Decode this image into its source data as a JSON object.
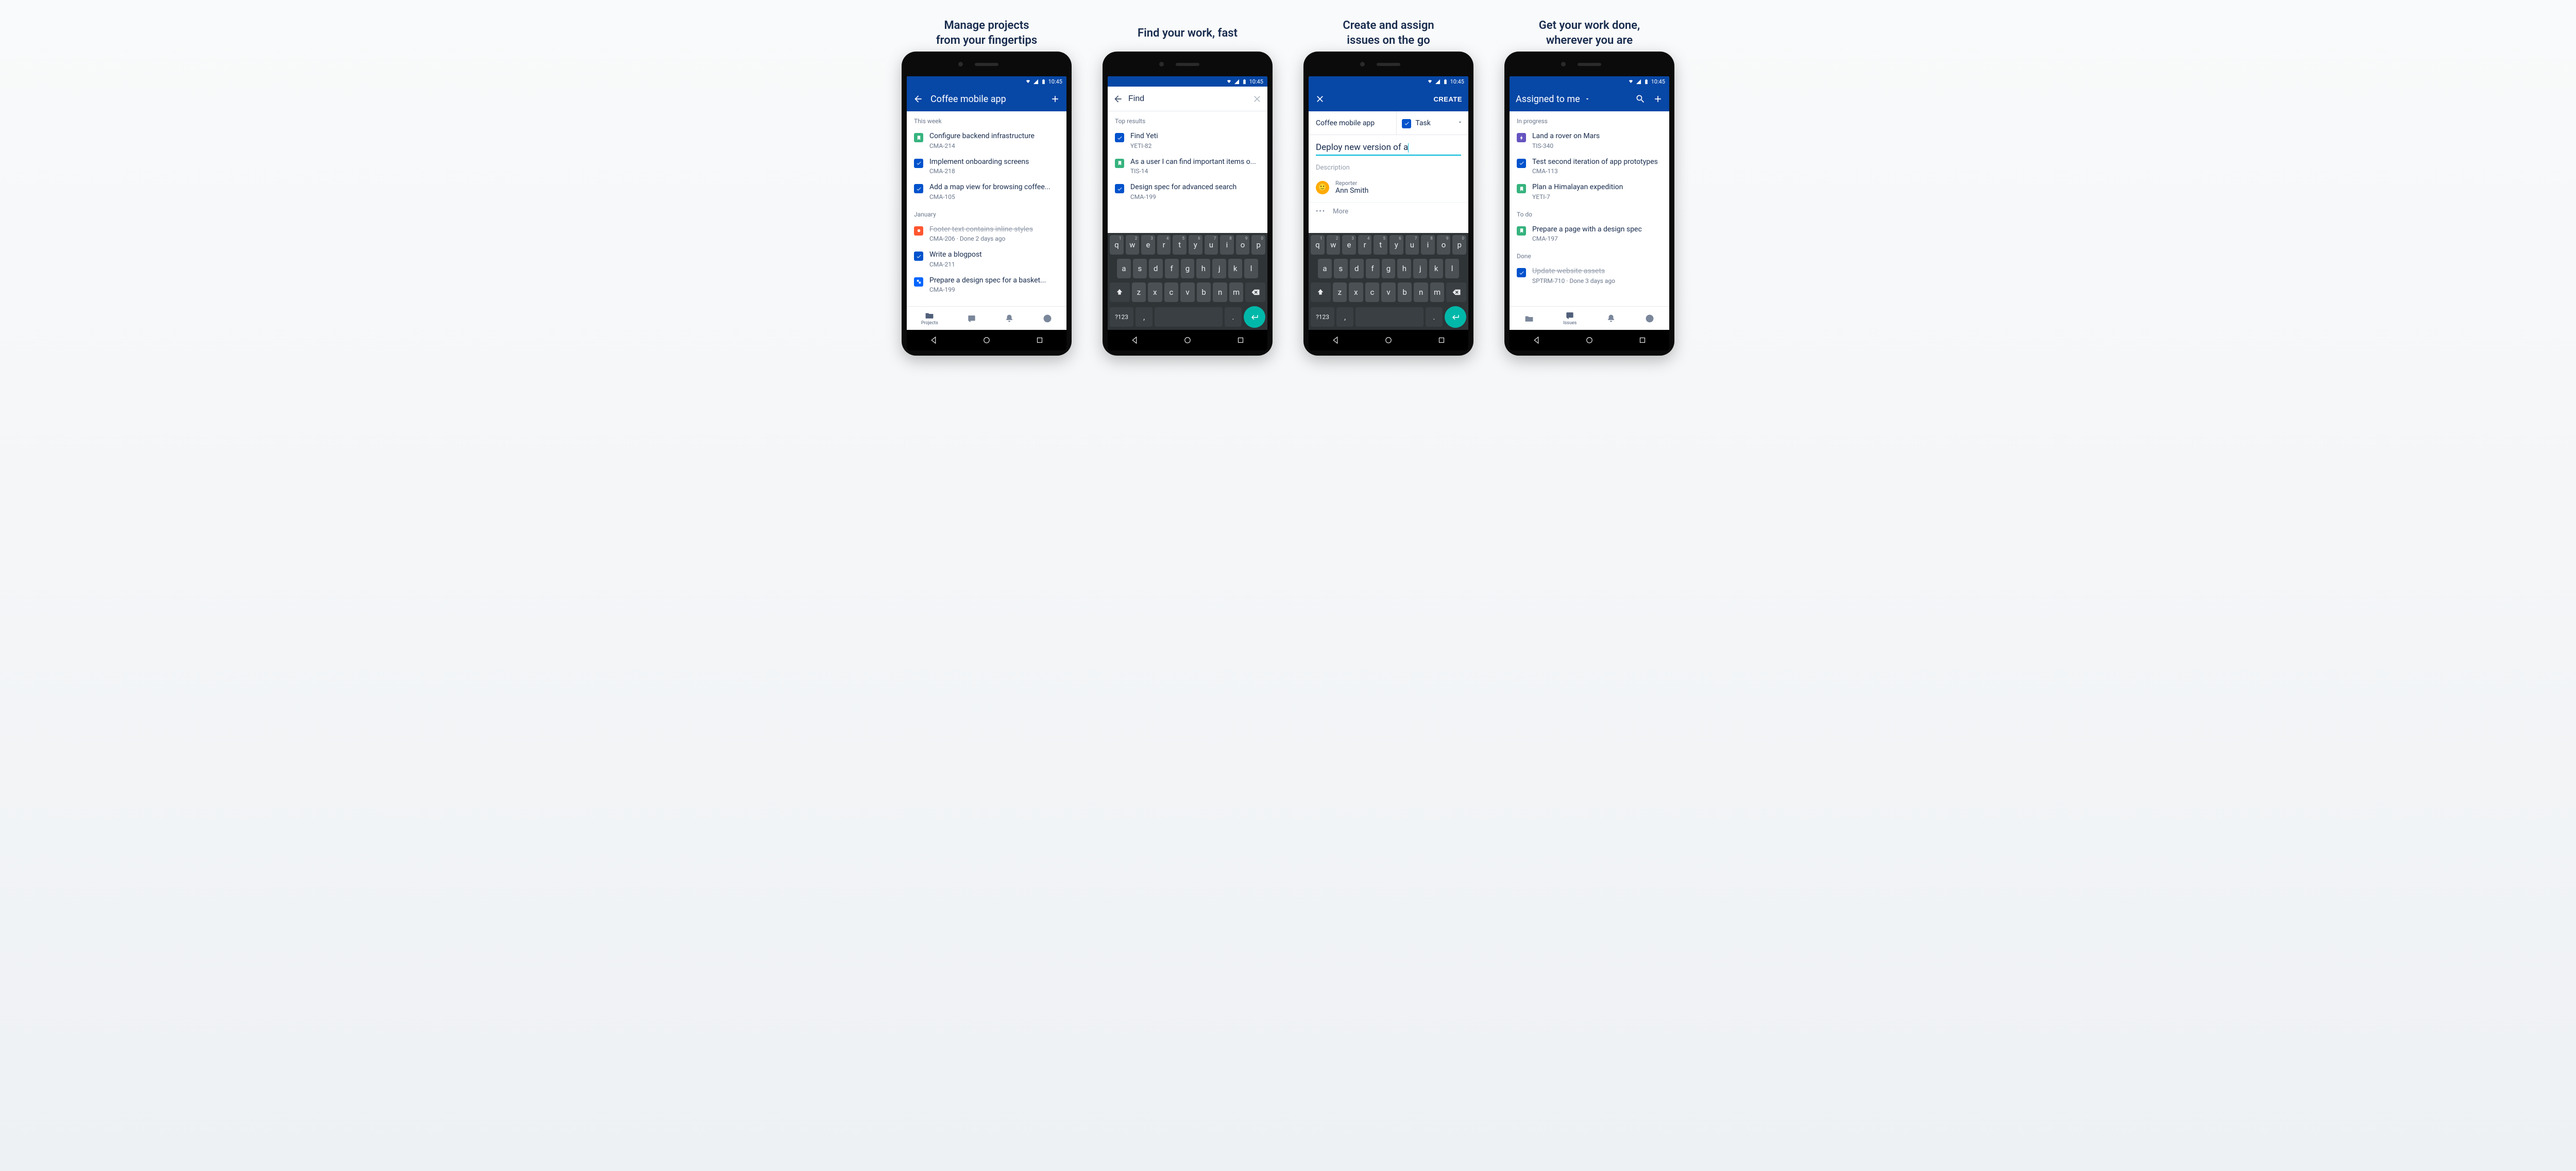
{
  "time": "10:45",
  "headlines": [
    "Manage projects\nfrom your fingertips",
    "Find your work, fast",
    "Create and assign\nissues on the go",
    "Get your work done,\nwherever you are"
  ],
  "screen1": {
    "title": "Coffee mobile app",
    "groups": [
      {
        "label": "This week",
        "items": [
          {
            "icon": "story",
            "title": "Configure backend infrastructure",
            "key": "CMA-214"
          },
          {
            "icon": "task",
            "title": "Implement onboarding screens",
            "key": "CMA-218"
          },
          {
            "icon": "task",
            "title": "Add a map view for browsing coffee...",
            "key": "CMA-105"
          }
        ]
      },
      {
        "label": "January",
        "items": [
          {
            "icon": "bug",
            "title": "Footer text contains inline styles",
            "key": "CMA-206 · Done 2 days ago",
            "done": true
          },
          {
            "icon": "task",
            "title": "Write a blogpost",
            "key": "CMA-211"
          },
          {
            "icon": "sub",
            "title": "Prepare a design spec for a basket...",
            "key": "CMA-199"
          }
        ]
      }
    ],
    "nav_active": "Projects"
  },
  "screen2": {
    "search_value": "Find",
    "section": "Top results",
    "items": [
      {
        "icon": "task",
        "title": "Find Yeti",
        "key": "YETI-82"
      },
      {
        "icon": "story",
        "title": "As a user I can find important items o...",
        "key": "TIS-14"
      },
      {
        "icon": "task",
        "title": "Design spec for advanced search",
        "key": "CMA-199"
      }
    ]
  },
  "screen3": {
    "action": "CREATE",
    "project": "Coffee mobile app",
    "type": "Task",
    "summary": "Deploy new version of a",
    "desc_ph": "Description",
    "reporter_label": "Reporter",
    "reporter_name": "Ann Smith",
    "more": "More"
  },
  "screen4": {
    "title": "Assigned to me",
    "groups": [
      {
        "label": "In progress",
        "items": [
          {
            "icon": "epic",
            "title": "Land a rover on Mars",
            "key": "TIS-340"
          },
          {
            "icon": "task",
            "title": "Test second iteration of app prototypes",
            "key": "CMA-113"
          },
          {
            "icon": "story",
            "title": "Plan a Himalayan expedition",
            "key": "YETI-7"
          }
        ]
      },
      {
        "label": "To do",
        "items": [
          {
            "icon": "story",
            "title": "Prepare a page with a design spec",
            "key": "CMA-197"
          }
        ]
      },
      {
        "label": "Done",
        "items": [
          {
            "icon": "task",
            "title": "Update website assets",
            "key": "SPTRM-710 · Done 3 days ago",
            "done": true
          }
        ]
      }
    ],
    "nav_active": "Issues"
  },
  "keyboard": {
    "r1": [
      "q",
      "w",
      "e",
      "r",
      "t",
      "y",
      "u",
      "i",
      "o",
      "p"
    ],
    "n1": [
      "1",
      "2",
      "3",
      "4",
      "5",
      "6",
      "7",
      "8",
      "9",
      "0"
    ],
    "r2": [
      "a",
      "s",
      "d",
      "f",
      "g",
      "h",
      "j",
      "k",
      "l"
    ],
    "r3": [
      "z",
      "x",
      "c",
      "v",
      "b",
      "n",
      "m"
    ],
    "sym": "?123"
  },
  "bottomnav": [
    "Projects",
    "Issues",
    "Notifications",
    "Account"
  ]
}
